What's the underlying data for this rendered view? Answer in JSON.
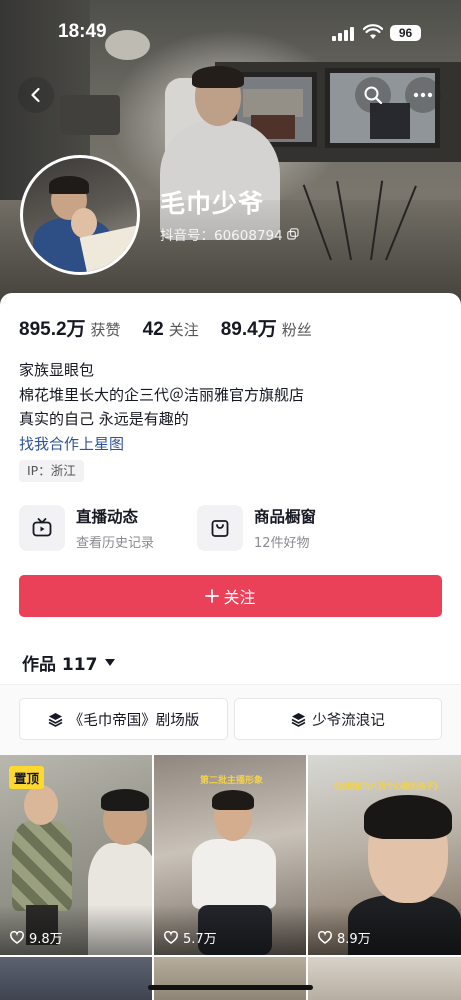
{
  "status_bar": {
    "time": "18:49",
    "battery": "96"
  },
  "profile": {
    "name": "毛巾少爷",
    "douyin_id": "抖音号：60608794"
  },
  "stats": [
    {
      "value": "895.2万",
      "label": "获赞"
    },
    {
      "value": "42",
      "label": "关注"
    },
    {
      "value": "89.4万",
      "label": "粉丝"
    }
  ],
  "bio": {
    "lines": [
      "家族显眼包",
      "棉花堆里长大的企三代＠洁丽雅官方旗舰店",
      "真实的自己 永远是有趣的"
    ],
    "link": "找我合作上星图"
  },
  "ip": "IP：浙江",
  "features": [
    {
      "title": "直播动态",
      "subtitle": "查看历史记录",
      "icon": "tv-icon"
    },
    {
      "title": "商品橱窗",
      "subtitle": "12件好物",
      "icon": "bag-icon"
    }
  ],
  "follow_button": {
    "label": "关注",
    "color": "#ea4159"
  },
  "works_tab": "作品 117",
  "collections": [
    {
      "label": "《毛巾帝国》剧场版"
    },
    {
      "label": "少爷流浪记"
    }
  ],
  "videos": [
    {
      "likes": "9.8万",
      "badge": "置顶",
      "caption": ""
    },
    {
      "likes": "5.7万",
      "badge": "",
      "caption": "第二批主播形象"
    },
    {
      "likes": "8.9万",
      "badge": "",
      "caption": "《总裁和他八百个心眼的孩子》"
    }
  ]
}
